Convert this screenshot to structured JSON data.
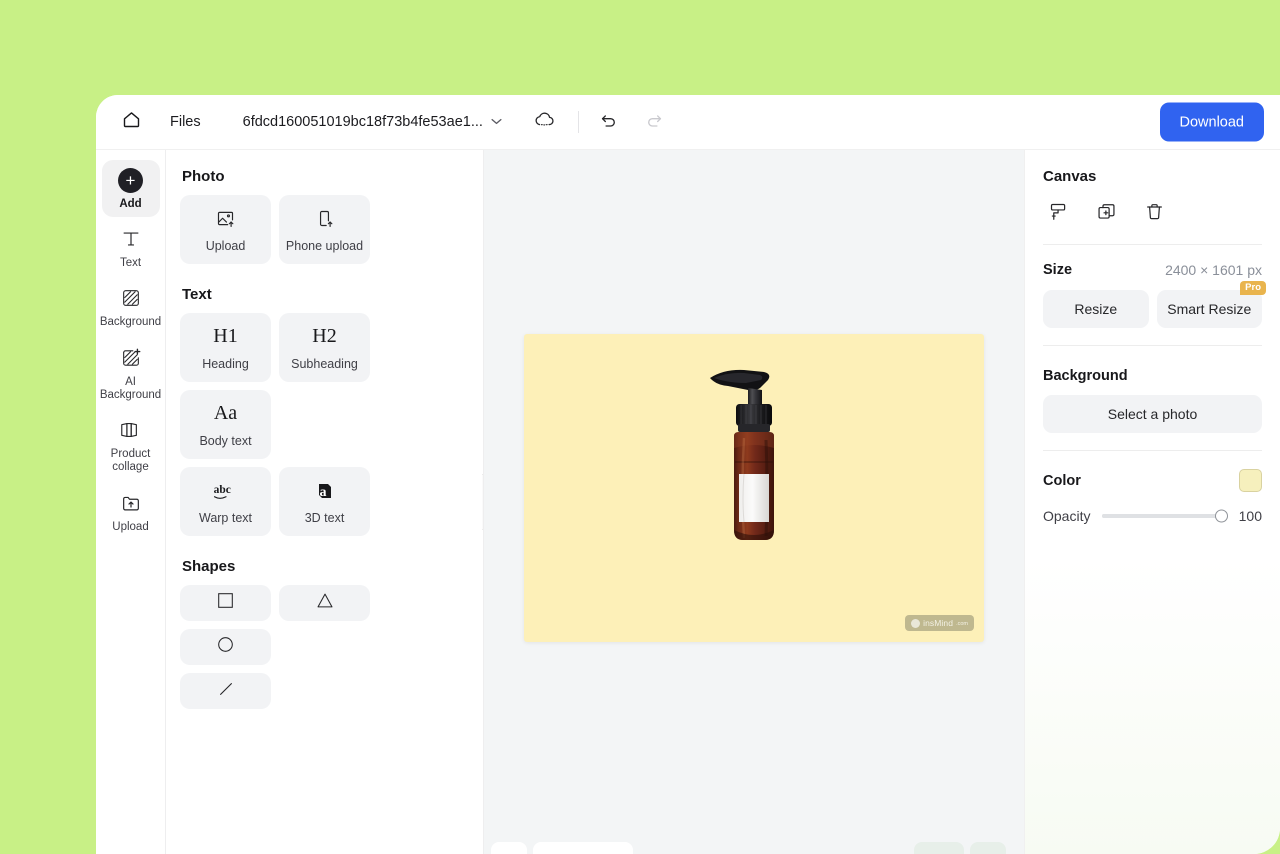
{
  "topbar": {
    "home_icon": "home-icon",
    "files_label": "Files",
    "doc_name": "6fdcd160051019bc18f73b4fe53ae1...",
    "chevron": "⌄",
    "cloud_icon": "cloud-sync-icon",
    "undo_icon": "undo-icon",
    "redo_icon": "redo-icon",
    "download_label": "Download"
  },
  "rail": {
    "items": [
      {
        "label": "Add",
        "icon": "plus-circle-icon",
        "active": true
      },
      {
        "label": "Text",
        "icon": "text-t-icon",
        "active": false
      },
      {
        "label": "Background",
        "icon": "hatch-square-icon",
        "active": false
      },
      {
        "label": "AI\nBackground",
        "icon": "hatch-sparkle-icon",
        "active": false
      },
      {
        "label": "Product\ncollage",
        "icon": "collage-icon",
        "active": false
      },
      {
        "label": "Upload",
        "icon": "folder-upload-icon",
        "active": false
      }
    ]
  },
  "tool_panel": {
    "photo_title": "Photo",
    "photo_tiles": [
      {
        "label": "Upload",
        "icon": "image-upload-icon"
      },
      {
        "label": "Phone upload",
        "icon": "phone-upload-icon"
      }
    ],
    "text_title": "Text",
    "text_tiles": [
      {
        "label": "Heading",
        "glyph": "H1"
      },
      {
        "label": "Subheading",
        "glyph": "H2"
      },
      {
        "label": "Body text",
        "glyph": "Aa"
      },
      {
        "label": "Warp text",
        "glyph": "abc",
        "icon": "warp-text-icon"
      },
      {
        "label": "3D text",
        "glyph": "a",
        "icon": "three-d-text-icon"
      }
    ],
    "shapes_title": "Shapes",
    "shapes": [
      {
        "name": "square-shape",
        "icon": "square-icon"
      },
      {
        "name": "triangle-shape",
        "icon": "triangle-icon"
      },
      {
        "name": "circle-shape",
        "icon": "circle-icon"
      },
      {
        "name": "line-shape",
        "icon": "line-icon"
      }
    ],
    "collapse_icon": "chevron-left-icon"
  },
  "canvas": {
    "background_color": "#fdf0b8",
    "watermark_text": "insMind",
    "watermark_suffix": ".com",
    "product": "amber-pump-bottle"
  },
  "right_panel": {
    "title": "Canvas",
    "tools": [
      {
        "name": "paint-roller-icon"
      },
      {
        "name": "duplicate-icon"
      },
      {
        "name": "trash-icon"
      }
    ],
    "size_label": "Size",
    "size_value": "2400 × 1601 px",
    "resize_label": "Resize",
    "smart_resize_label": "Smart Resize",
    "pro_badge": "Pro",
    "background_label": "Background",
    "select_photo_label": "Select a photo",
    "color_label": "Color",
    "color_value": "#f6f0bd",
    "opacity_label": "Opacity",
    "opacity_value": "100"
  },
  "theme": {
    "page_background": "#c8f086",
    "accent": "#3063f0",
    "pro_badge_color": "#e9b44d"
  }
}
